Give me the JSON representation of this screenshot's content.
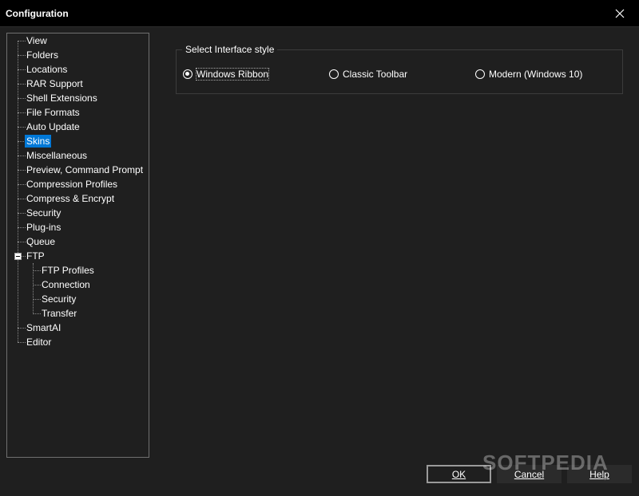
{
  "window": {
    "title": "Configuration"
  },
  "tree": {
    "items": [
      {
        "label": "View"
      },
      {
        "label": "Folders"
      },
      {
        "label": "Locations"
      },
      {
        "label": "RAR Support"
      },
      {
        "label": "Shell Extensions"
      },
      {
        "label": "File Formats"
      },
      {
        "label": "Auto Update"
      },
      {
        "label": "Skins",
        "selected": true
      },
      {
        "label": "Miscellaneous"
      },
      {
        "label": "Preview, Command Prompt"
      },
      {
        "label": "Compression Profiles"
      },
      {
        "label": "Compress & Encrypt"
      },
      {
        "label": "Security"
      },
      {
        "label": "Plug-ins"
      },
      {
        "label": "Queue"
      },
      {
        "label": "FTP",
        "expanded": true
      },
      {
        "label": "FTP Profiles",
        "child": true
      },
      {
        "label": "Connection",
        "child": true
      },
      {
        "label": "Security",
        "child": true
      },
      {
        "label": "Transfer",
        "child": true
      },
      {
        "label": "SmartAI"
      },
      {
        "label": "Editor"
      }
    ]
  },
  "interface_style": {
    "group_title": "Select Interface style",
    "options": [
      {
        "label": "Windows Ribbon",
        "checked": true
      },
      {
        "label": "Classic Toolbar",
        "checked": false
      },
      {
        "label": "Modern (Windows 10)",
        "checked": false
      }
    ]
  },
  "buttons": {
    "ok": "OK",
    "cancel": "Cancel",
    "help": "Help"
  },
  "watermark": "SOFTPEDIA",
  "colors": {
    "background": "#1f1f1f",
    "titlebar": "#000000",
    "selection": "#0078d7"
  },
  "icons": {
    "close": "close-icon",
    "expander": "tree-collapse-icon"
  }
}
